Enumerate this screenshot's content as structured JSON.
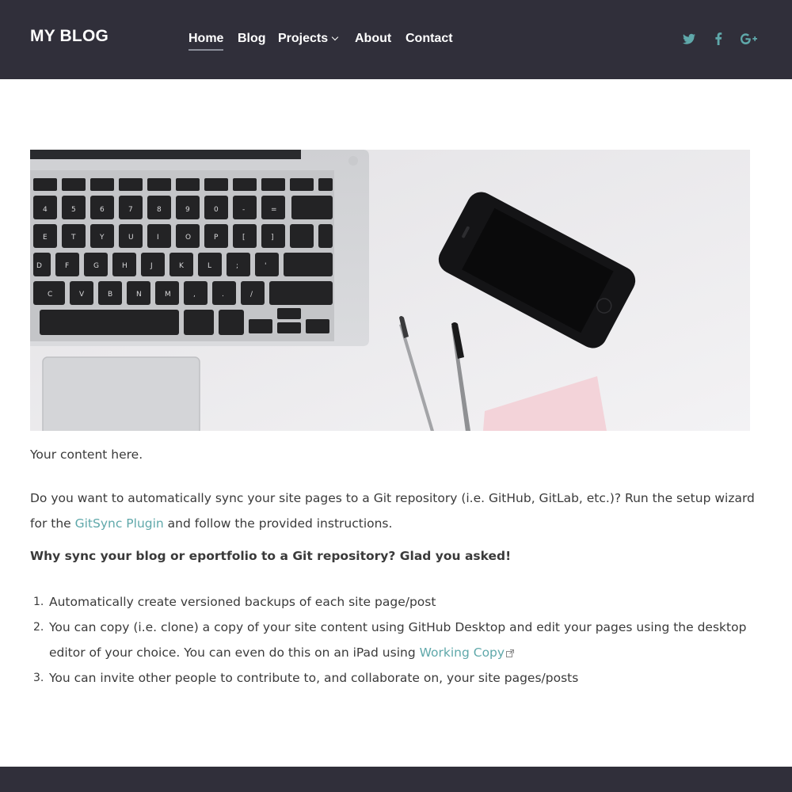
{
  "header": {
    "brand": "MY BLOG",
    "nav": [
      {
        "label": "Home",
        "active": true
      },
      {
        "label": "Blog"
      },
      {
        "label": "Projects",
        "has_dropdown": true
      },
      {
        "label": "About"
      },
      {
        "label": "Contact"
      }
    ],
    "social": [
      "twitter-icon",
      "facebook-icon",
      "google-plus-icon"
    ]
  },
  "colors": {
    "header_bg": "#302f3a",
    "accent": "#5fa8aa",
    "text": "#3a3a3a"
  },
  "content": {
    "intro": "Your content here.",
    "sync_before": "Do you want to automatically sync your site pages to a Git repository (i.e. GitHub, GitLab, etc.)? Run the setup wizard for the ",
    "sync_link": "GitSync Plugin",
    "sync_after": " and follow the provided instructions.",
    "why": "Why sync your blog or eportfolio to a Git repository? Glad you asked!",
    "list": {
      "item1": "Automatically create versioned backups of each site page/post",
      "item2_before": "You can copy (i.e. clone) a copy of your site content using GitHub Desktop and edit your pages using the desktop editor of your choice. You can even do this on an iPad using ",
      "item2_link": "Working Copy",
      "item3": "You can invite other people to contribute to, and collaborate on, your site pages/posts"
    },
    "list_numbers": [
      "1.",
      "2.",
      "3."
    ]
  }
}
